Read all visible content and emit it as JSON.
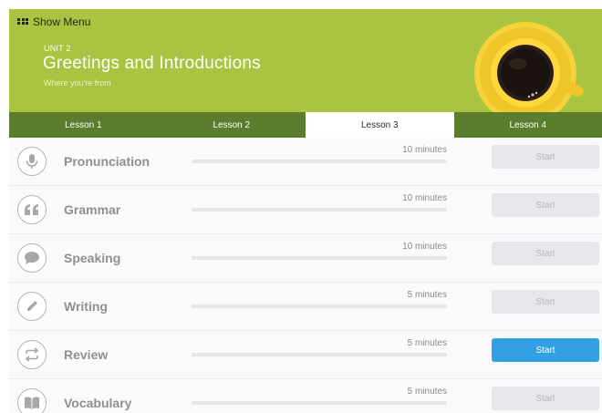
{
  "header": {
    "menu_label": "Show Menu",
    "unit_label": "UNIT 2",
    "title": "Greetings and Introductions",
    "subtitle": "Where you're from"
  },
  "tabs": [
    {
      "label": "Lesson 1",
      "active": false
    },
    {
      "label": "Lesson 2",
      "active": false
    },
    {
      "label": "Lesson 3",
      "active": true
    },
    {
      "label": "Lesson 4",
      "active": false
    }
  ],
  "activities": [
    {
      "title": "Pronunciation",
      "icon": "microphone-icon",
      "duration": "10 minutes",
      "progress": 0,
      "button": "Start",
      "primary": false
    },
    {
      "title": "Grammar",
      "icon": "quote-icon",
      "duration": "10 minutes",
      "progress": 0,
      "button": "Start",
      "primary": false
    },
    {
      "title": "Speaking",
      "icon": "speech-bubble-icon",
      "duration": "10 minutes",
      "progress": 0,
      "button": "Start",
      "primary": false
    },
    {
      "title": "Writing",
      "icon": "pencil-icon",
      "duration": "5 minutes",
      "progress": 0,
      "button": "Start",
      "primary": false
    },
    {
      "title": "Review",
      "icon": "repeat-icon",
      "duration": "5 minutes",
      "progress": 0,
      "button": "Start",
      "primary": true
    },
    {
      "title": "Vocabulary",
      "icon": "book-icon",
      "duration": "5 minutes",
      "progress": 0,
      "button": "Start",
      "primary": false
    }
  ],
  "colors": {
    "header_bg": "#a9c440",
    "tab_bar_bg": "#5b7d2e",
    "primary_button": "#33a0e6"
  }
}
